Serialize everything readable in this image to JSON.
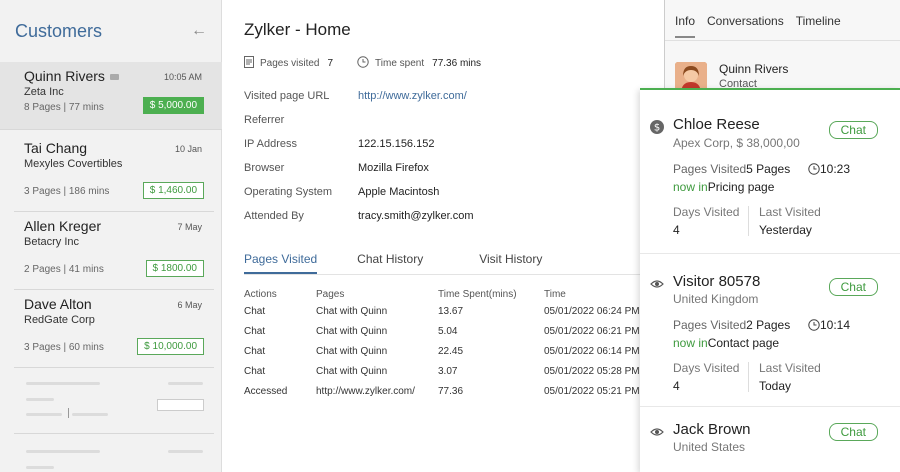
{
  "customers_panel": {
    "title": "Customers",
    "back_icon": "arrow-left-icon",
    "items": [
      {
        "name": "Quinn Rivers",
        "company": "Zeta Inc",
        "date": "10:05 AM",
        "meta": "8 Pages  |  77 mins",
        "amount": "$ 5,000.00"
      },
      {
        "name": "Tai Chang",
        "company": "Mexyles Covertibles",
        "date": "10 Jan",
        "meta": "3 Pages  |  186 mins",
        "amount": "$ 1,460.00"
      },
      {
        "name": "Allen Kreger",
        "company": "Betacry Inc",
        "date": "7 May",
        "meta": "2 Pages  |  41 mins",
        "amount": "$ 1800.00"
      },
      {
        "name": "Dave Alton",
        "company": "RedGate Corp",
        "date": "6 May",
        "meta": "3 Pages  |  60 mins",
        "amount": "$ 10,000.00"
      }
    ]
  },
  "main": {
    "title": "Zylker - Home",
    "stats": {
      "pages_label": "Pages visited",
      "pages_value": "7",
      "time_label": "Time spent",
      "time_value": "77.36 mins"
    },
    "details": [
      {
        "key": "Visited page URL",
        "value": "http://www.zylker.com/"
      },
      {
        "key": "Referrer",
        "value": ""
      },
      {
        "key": "IP Address",
        "value": "122.15.156.152"
      },
      {
        "key": "Browser",
        "value": "Mozilla Firefox"
      },
      {
        "key": "Operating System",
        "value": "Apple Macintosh"
      },
      {
        "key": "Attended By",
        "value": "tracy.smith@zylker.com"
      }
    ],
    "tabs": [
      "Pages Visited",
      "Chat History",
      "Visit History"
    ],
    "table": {
      "headers": [
        "Actions",
        "Pages",
        "Time Spent(mins)",
        "Time"
      ],
      "rows": [
        [
          "Chat",
          "Chat with Quinn",
          "13.67",
          "05/01/2022 06:24 PM"
        ],
        [
          "Chat",
          "Chat with Quinn",
          "5.04",
          "05/01/2022 06:21 PM"
        ],
        [
          "Chat",
          "Chat with Quinn",
          "22.45",
          "05/01/2022 06:14 PM"
        ],
        [
          "Chat",
          "Chat with Quinn",
          "3.07",
          "05/01/2022 05:28 PM"
        ],
        [
          "Accessed",
          "http://www.zylker.com/",
          "77.36",
          "05/01/2022 05:21 PM"
        ]
      ]
    }
  },
  "right_panel": {
    "tabs": [
      "Info",
      "Conversations",
      "Timeline"
    ],
    "contact_name": "Quinn Rivers",
    "contact_role": "Contact"
  },
  "visitors": [
    {
      "icon": "dollar-icon",
      "name": "Chloe Reese",
      "sub": "Apex Corp, $ 38,000,00",
      "chat": "Chat",
      "pages_label": "Pages Visited",
      "pages_value": "5 Pages",
      "time": "10:23",
      "now_label": "now in",
      "now_value": "Pricing page",
      "days_label": "Days Visited",
      "days_value": "4",
      "last_label": "Last Visited",
      "last_value": "Yesterday"
    },
    {
      "icon": "eye-icon",
      "name": "Visitor 80578",
      "sub": "United Kingdom",
      "chat": "Chat",
      "pages_label": "Pages Visited",
      "pages_value": "2 Pages",
      "time": "10:14",
      "now_label": "now in",
      "now_value": "Contact page",
      "days_label": "Days Visited",
      "days_value": "4",
      "last_label": "Last Visited",
      "last_value": "Today"
    },
    {
      "icon": "eye-icon",
      "name": "Jack Brown",
      "sub": "United States",
      "chat": "Chat"
    }
  ],
  "colors": {
    "accent": "#3f6b9a",
    "green": "#4caf50"
  }
}
